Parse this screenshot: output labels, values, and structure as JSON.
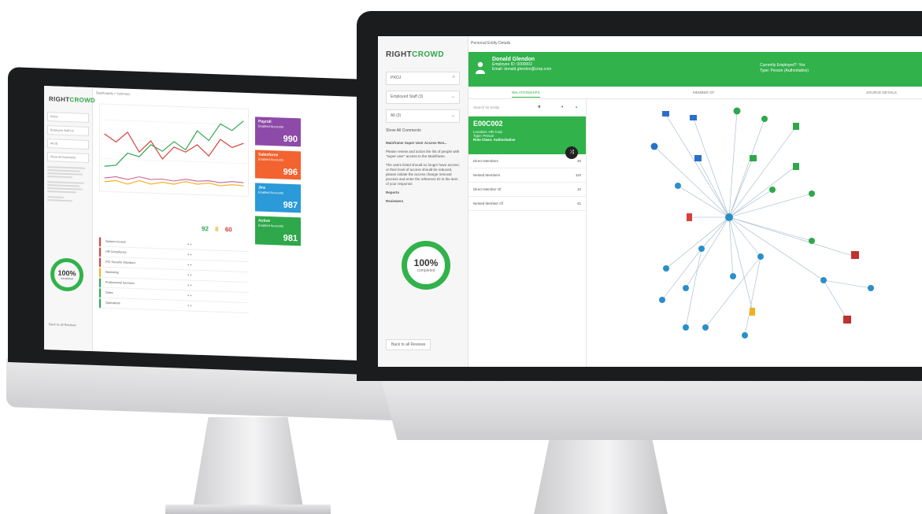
{
  "back_screen": {
    "logo": {
      "part1": "RIGHT",
      "part2": "CROWD"
    },
    "breadcrumb": "Dashboards > Summary",
    "sidebar_fields": [
      "PROJ",
      "Employed Staff (3)",
      "All (3)",
      "Show All Comments"
    ],
    "completion": {
      "percent": "100%",
      "label": "completed"
    },
    "back_label": "Back to all Reviews",
    "tiles": [
      {
        "title": "Payroll",
        "sub": "Enabled Accounts",
        "value": "990",
        "color": "#8e4aa8"
      },
      {
        "title": "Salesforce",
        "sub": "Enabled Accounts",
        "value": "996",
        "color": "#f2632f"
      },
      {
        "title": "Jira",
        "sub": "Enabled Accounts",
        "value": "987",
        "color": "#2a9ad8"
      },
      {
        "title": "Active",
        "sub": "Enabled Accounts",
        "value": "981",
        "color": "#2ea84a"
      }
    ],
    "table_rows": [
      "System Access",
      "HR Compliance",
      "PCI Security Standard",
      "Marketing",
      "Professional Services",
      "Sales",
      "Operations"
    ],
    "counts": [
      "92",
      "8",
      "60"
    ]
  },
  "front_screen": {
    "logo": {
      "part1": "RIGHT",
      "part2": "CROWD"
    },
    "breadcrumb": "Personal  Entity Details",
    "sidebar": {
      "search": "PROJ",
      "filter1": "Employed Staff (3)",
      "filter2": "All (3)",
      "show_comments": "Show All Comments",
      "paragraphs": [
        "Mainframe Super User Access Rev...",
        "Please review and action the list of people with \"super user\" access to the Mainframe.",
        "The users listed should no longer have access; or their level of access should be reduced, please initiate the access change removal process and enter the reference ID in the item of your response."
      ],
      "reports_label": "Reports",
      "reviewers_label": "Reviewers",
      "completion": {
        "percent": "100%",
        "label": "completed"
      },
      "back_label": "Back to all Reviews"
    },
    "header": {
      "name": "Donald Glendon",
      "employee_id": "Employee ID: 0000002",
      "email": "Email: donald.glendon@corp.com",
      "employed": "Currently Employed?: Yes",
      "type": "Type: Person (Authoritative)"
    },
    "tabs": [
      "RELATIONSHIPS",
      "MEMBER OF",
      "SOURCE DETAILS"
    ],
    "search_placeholder": "Search for Entity",
    "entity": {
      "code": "E00C002",
      "location": "Location: HR Corp",
      "type": "Type: Person",
      "role": "Role Class: Authoritative"
    },
    "relations": [
      {
        "label": "Direct Members",
        "count": "30"
      },
      {
        "label": "Nested Members",
        "count": "110"
      },
      {
        "label": "Direct Member Of",
        "count": "10"
      },
      {
        "label": "Nested Member Of",
        "count": "41"
      }
    ]
  },
  "colors": {
    "accent": "#31b24b"
  }
}
